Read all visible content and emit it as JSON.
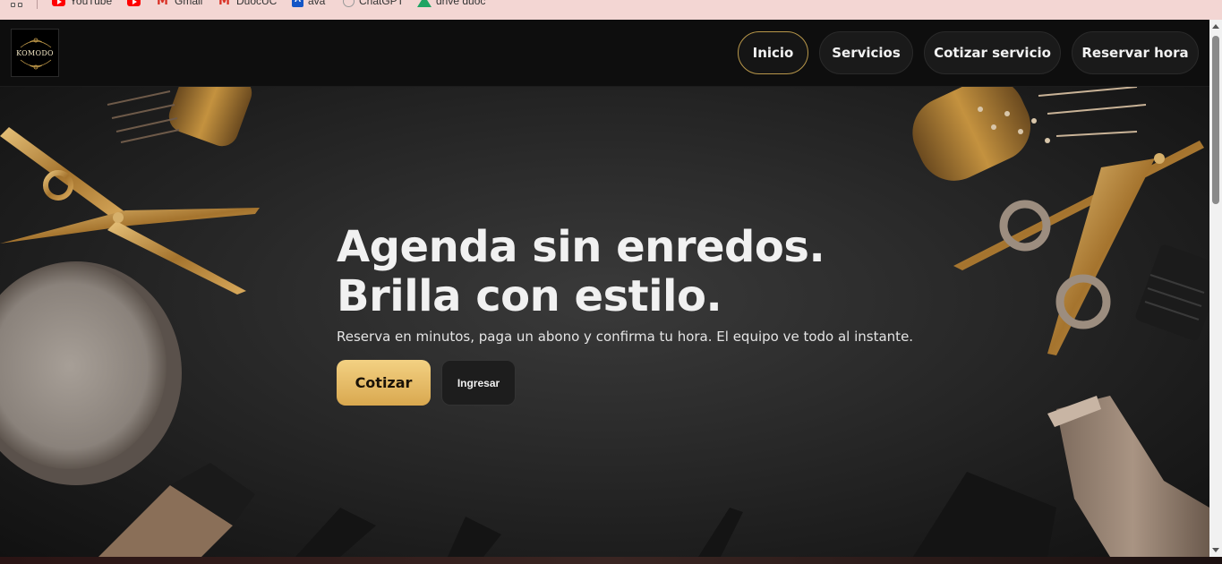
{
  "bookmarks": [
    {
      "label": "YouTube",
      "icon": "youtube-icon"
    },
    {
      "label": "",
      "icon": "youtube-icon"
    },
    {
      "label": "Gmail",
      "icon": "gmail-icon"
    },
    {
      "label": "DuocUC",
      "icon": "gmail-icon"
    },
    {
      "label": "ava",
      "icon": "ava-icon"
    },
    {
      "label": "ChatGPT",
      "icon": "chatgpt-icon"
    },
    {
      "label": "drive duoc",
      "icon": "google-drive-icon"
    }
  ],
  "logo": {
    "text": "KOMODO"
  },
  "nav": {
    "inicio": "Inicio",
    "servicios": "Servicios",
    "cotizar": "Cotizar servicio",
    "reservar": "Reservar hora"
  },
  "hero": {
    "headline_line1": "Agenda sin enredos.",
    "headline_line2": "Brilla con estilo.",
    "subline": "Reserva en minutos, paga un abono y confirma tu hora. El equipo ve todo al instante.",
    "primary_button": "Cotizar",
    "secondary_button": "Ingresar"
  },
  "colors": {
    "accent_gold": "#e0b460",
    "nav_active_border": "#b8974a",
    "background": "#0e0e0e"
  }
}
